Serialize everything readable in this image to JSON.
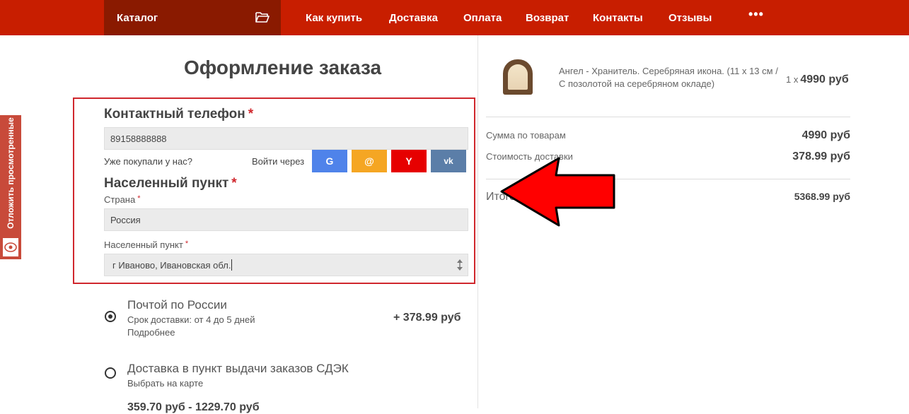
{
  "nav": {
    "catalog": "Каталог",
    "items": [
      "Как купить",
      "Доставка",
      "Оплата",
      "Возврат",
      "Контакты",
      "Отзывы"
    ],
    "more": "•••"
  },
  "side_tab": {
    "label": "Отложить просмотренные"
  },
  "page": {
    "title": "Оформление заказа"
  },
  "contact": {
    "heading": "Контактный телефон",
    "required_mark": "*",
    "phone_value": "89158888888",
    "bought_before": "Уже покупали у нас?",
    "login_with": "Войти через",
    "social": [
      "G",
      "@",
      "Y",
      "vk"
    ]
  },
  "location": {
    "heading": "Населенный пункт",
    "required_mark": "*",
    "country_label": "Страна",
    "country_value": "Россия",
    "city_label": "Населенный пункт",
    "city_value": "г Иваново, Ивановская обл."
  },
  "delivery": [
    {
      "title": "Почтой по России",
      "line1": "Срок доставки: от 4 до 5 дней",
      "line2": "Подробнее",
      "price": "+ 378.99 руб",
      "selected": true
    },
    {
      "title": "Доставка в пункт выдачи заказов СДЭК",
      "line1": "Выбрать на карте",
      "price": "359.70 руб - 1229.70 руб",
      "selected": false
    }
  ],
  "cart": {
    "product_name": "Ангел - Хранитель. Серебряная икона. (11 х 13 см / С позолотой на серебряном окладе)",
    "qty_prefix": "1 x",
    "product_price": "4990 руб",
    "goods_sum_label": "Сумма по товарам",
    "goods_sum_value": "4990 руб",
    "shipping_label": "Стоимость доставки",
    "shipping_value": "378.99 руб",
    "total_label": "Итого",
    "total_value": "5368.99 руб"
  },
  "colors": {
    "nav_bg": "#c81e00",
    "catalog_bg": "#8a1a00",
    "frame": "#d0272d",
    "arrow": "#ff0000"
  }
}
